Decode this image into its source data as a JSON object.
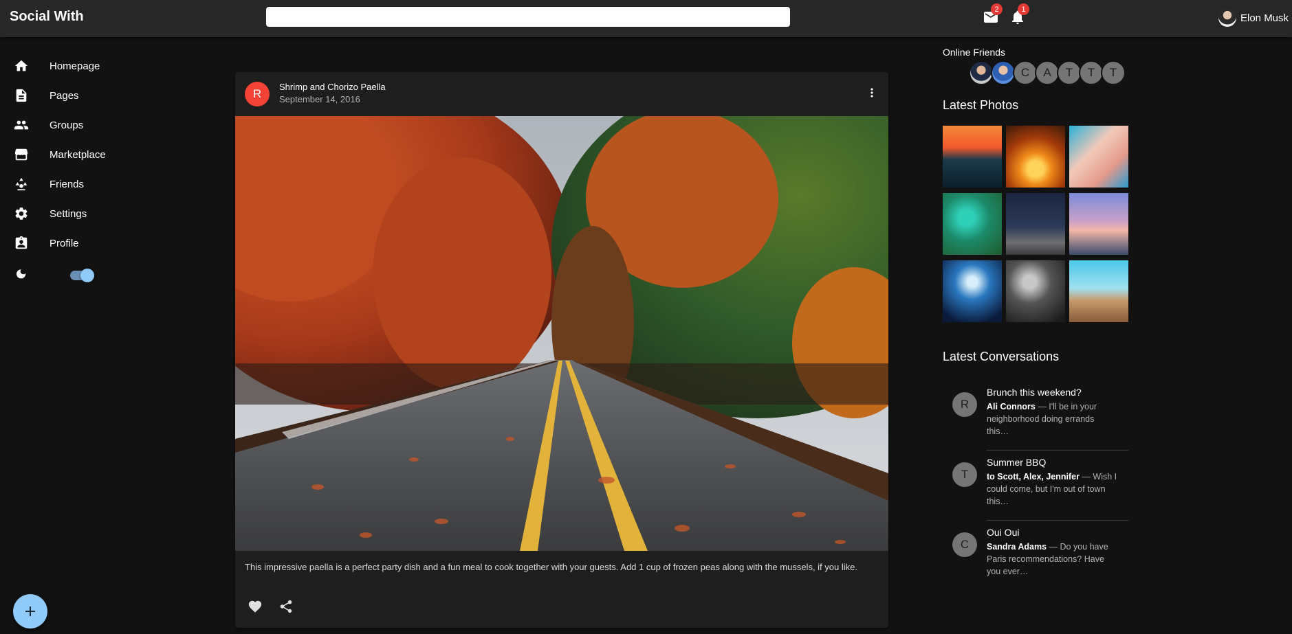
{
  "app": {
    "brand": "Social With",
    "search_placeholder": "",
    "mail_badge": "2",
    "notification_badge": "1",
    "user_name": "Elon Musk"
  },
  "sidebar": {
    "items": [
      {
        "label": "Homepage",
        "icon": "home-icon"
      },
      {
        "label": "Pages",
        "icon": "article-icon"
      },
      {
        "label": "Groups",
        "icon": "people-icon"
      },
      {
        "label": "Marketplace",
        "icon": "storefront-icon"
      },
      {
        "label": "Friends",
        "icon": "person-search-icon"
      },
      {
        "label": "Settings",
        "icon": "gear-icon"
      },
      {
        "label": "Profile",
        "icon": "account-box-icon"
      }
    ],
    "dark_mode": true,
    "fab_icon": "add-icon"
  },
  "post": {
    "avatar_letter": "R",
    "title": "Shrimp and Chorizo Paella",
    "date": "September 14, 2016",
    "text": "This impressive paella is a perfect party dish and a fun meal to cook together with your guests. Add 1 cup of frozen peas along with the mussels, if you like.",
    "image": "autumn-road-photo"
  },
  "rightbar": {
    "online_heading": "Online Friends",
    "online_letters": [
      "C",
      "A",
      "T",
      "T",
      "T"
    ],
    "photos_heading": "Latest Photos",
    "conversations_heading": "Latest Conversations",
    "conversations": [
      {
        "avatar": "R",
        "title": "Brunch this weekend?",
        "who": "Ali Connors",
        "snippet": " — I'll be in your neighborhood doing errands this…"
      },
      {
        "avatar": "T",
        "title": "Summer BBQ",
        "who": "to Scott, Alex, Jennifer",
        "snippet": " — Wish I could come, but I'm out of town this…"
      },
      {
        "avatar": "C",
        "title": "Oui Oui",
        "who": "Sandra Adams",
        "snippet": " — Do you have Paris recommendations? Have you ever…"
      }
    ]
  },
  "colors": {
    "background": "#121212",
    "appbar": "#272727",
    "card": "#1e1e1e",
    "accent": "#90caf9",
    "badge": "#e53935",
    "post_avatar": "#f44336"
  }
}
